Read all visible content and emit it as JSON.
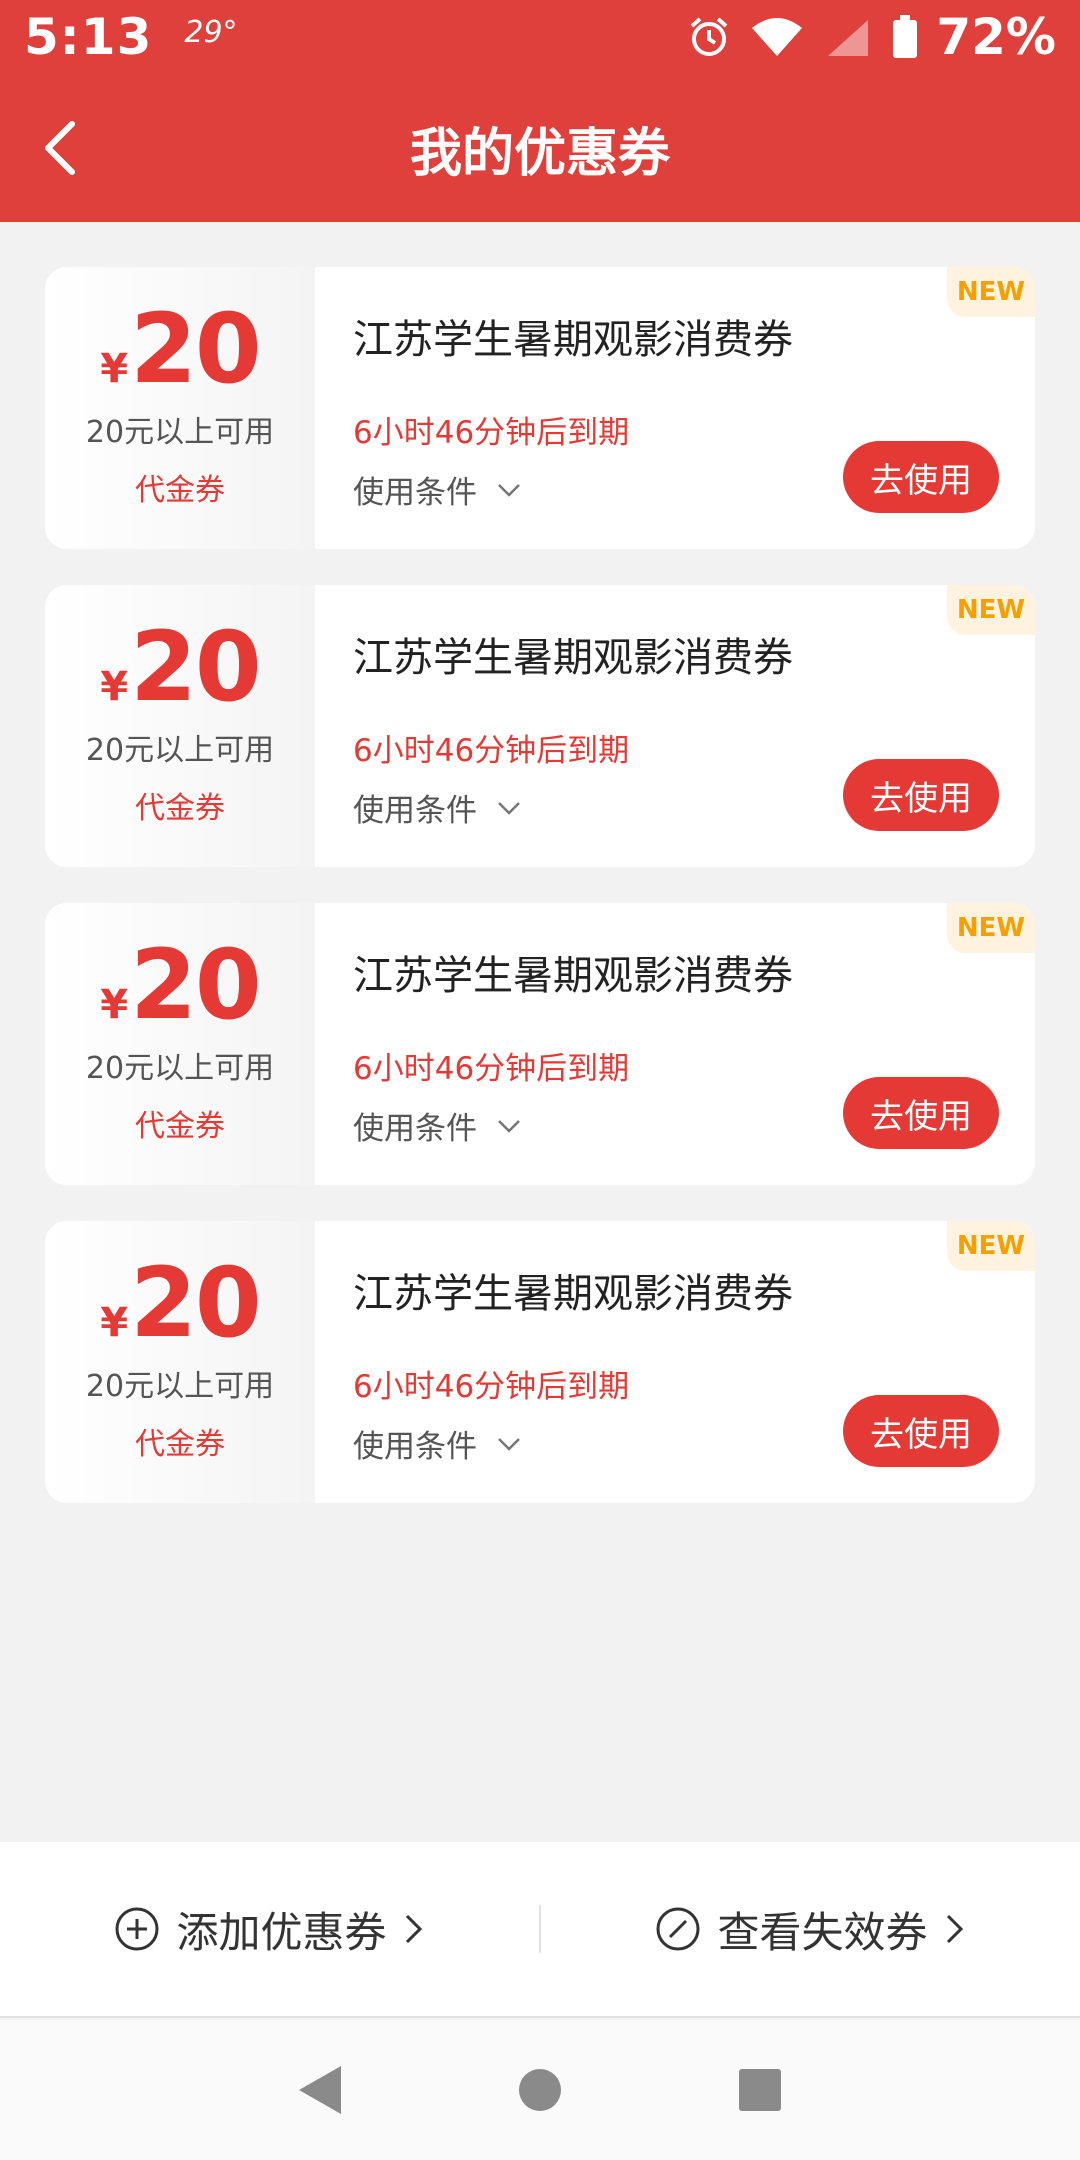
{
  "status_bar": {
    "time": "5:13",
    "temp": "29°",
    "battery": "72%",
    "icons": [
      "alarm-icon",
      "wifi-icon",
      "signal-icon",
      "battery-icon"
    ]
  },
  "header": {
    "title": "我的优惠券",
    "back_icon": "chevron-left-icon",
    "color": "#e0403b"
  },
  "coupons": [
    {
      "currency": "¥",
      "amount": "20",
      "condition": "20元以上可用",
      "type": "代金券",
      "title": "江苏学生暑期观影消费券",
      "expiry": "6小时46分钟后到期",
      "conditions_label": "使用条件",
      "button": "去使用",
      "badge": "NEW"
    },
    {
      "currency": "¥",
      "amount": "20",
      "condition": "20元以上可用",
      "type": "代金券",
      "title": "江苏学生暑期观影消费券",
      "expiry": "6小时46分钟后到期",
      "conditions_label": "使用条件",
      "button": "去使用",
      "badge": "NEW"
    },
    {
      "currency": "¥",
      "amount": "20",
      "condition": "20元以上可用",
      "type": "代金券",
      "title": "江苏学生暑期观影消费券",
      "expiry": "6小时46分钟后到期",
      "conditions_label": "使用条件",
      "button": "去使用",
      "badge": "NEW"
    },
    {
      "currency": "¥",
      "amount": "20",
      "condition": "20元以上可用",
      "type": "代金券",
      "title": "江苏学生暑期观影消费券",
      "expiry": "6小时46分钟后到期",
      "conditions_label": "使用条件",
      "button": "去使用",
      "badge": "NEW"
    }
  ],
  "bottom_actions": {
    "add_label": "添加优惠券",
    "expired_label": "查看失效券"
  },
  "colors": {
    "accent": "#e53935",
    "badge_text": "#f59f00"
  }
}
